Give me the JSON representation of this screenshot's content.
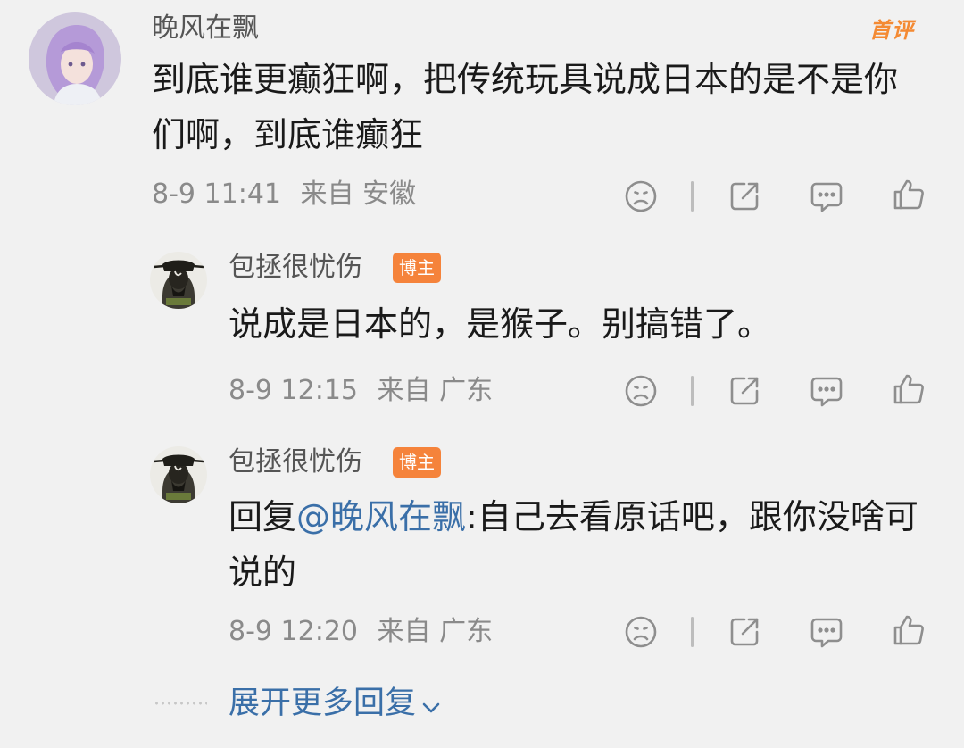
{
  "top_comment": {
    "username": "晚风在飘",
    "badge": "首评",
    "content": "到底谁更癫狂啊，把传统玩具说成日本的是不是你们啊，到底谁癫狂",
    "time": "8-9 11:41",
    "location": "来自 安徽"
  },
  "replies": [
    {
      "username": "包拯很忧伤",
      "badge": "博主",
      "content": "说成是日本的，是猴子。别搞错了。",
      "time": "8-9 12:15",
      "location": "来自 广东"
    },
    {
      "username": "包拯很忧伤",
      "badge": "博主",
      "reply_prefix": "回复",
      "mention": "@晚风在飘",
      "content": ":自己去看原话吧，跟你没啥可说的",
      "time": "8-9 12:20",
      "location": "来自 广东"
    }
  ],
  "expand_label": "展开更多回复",
  "icons": {
    "dislike": "sad-face-icon",
    "share": "share-icon",
    "comment": "comment-icon",
    "like": "thumbs-up-icon",
    "expand": "chevron-down-icon"
  },
  "colors": {
    "background": "#f1f1f1",
    "link": "#3a6fa8",
    "badge_orange": "#f5833b",
    "meta_gray": "#8a8a8a"
  }
}
